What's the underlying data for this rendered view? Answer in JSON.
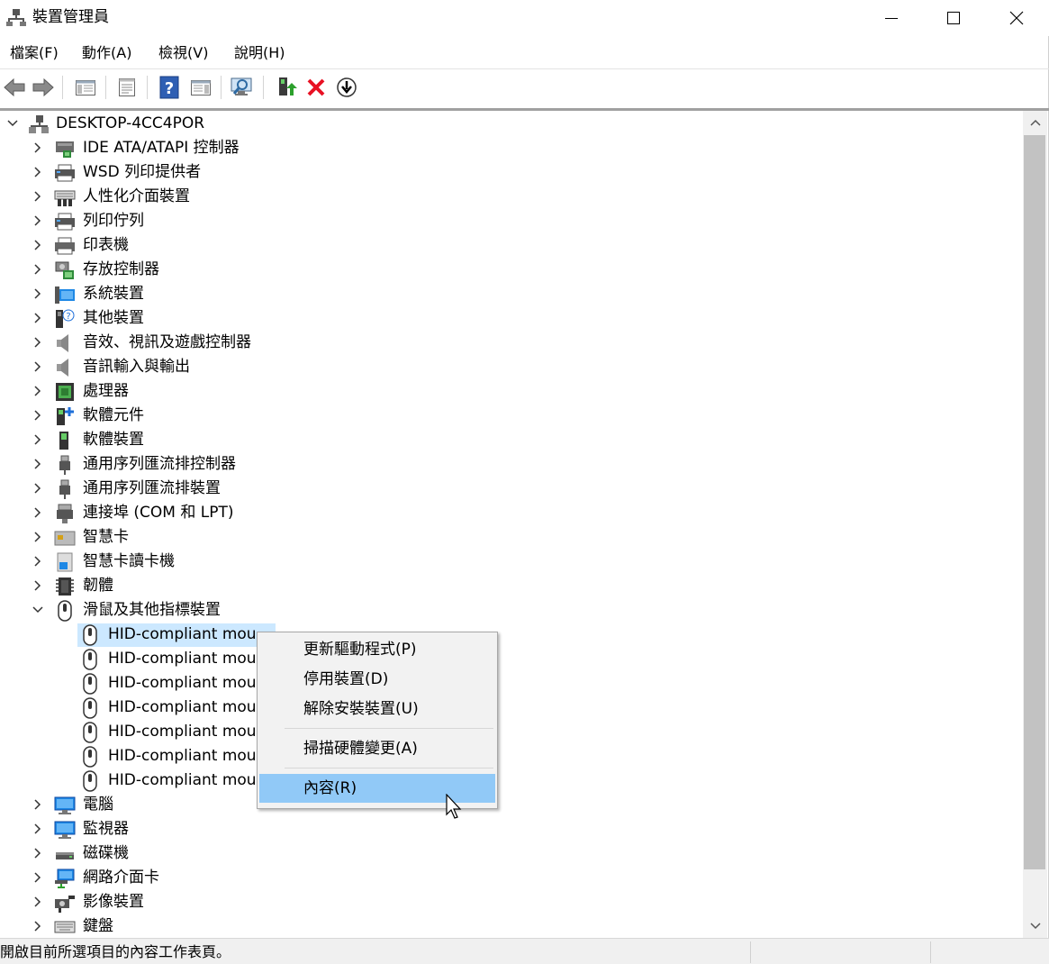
{
  "window": {
    "title": "裝置管理員",
    "controls": {
      "minimize": "minimize-icon",
      "maximize": "maximize-icon",
      "close": "close-icon"
    }
  },
  "menubar": [
    {
      "label": "檔案(F)"
    },
    {
      "label": "動作(A)"
    },
    {
      "label": "檢視(V)"
    },
    {
      "label": "說明(H)"
    }
  ],
  "toolbar": {
    "icons": [
      "back-icon",
      "forward-icon",
      "show-hide-console-tree-icon",
      "properties-icon",
      "help-icon",
      "action-pane-icon",
      "scan-hardware-icon",
      "update-driver-icon",
      "uninstall-icon",
      "enable-device-icon"
    ],
    "accent_red": "#e81123"
  },
  "tree": {
    "root": {
      "label": "DESKTOP-4CC4POR",
      "expanded": true
    },
    "categories": [
      {
        "label": "IDE ATA/ATAPI 控制器",
        "icon": "ide-controller-icon"
      },
      {
        "label": "WSD 列印提供者",
        "icon": "wsd-printer-icon"
      },
      {
        "label": "人性化介面裝置",
        "icon": "hid-keyboard-icon"
      },
      {
        "label": "列印佇列",
        "icon": "print-queue-icon"
      },
      {
        "label": "印表機",
        "icon": "printer-icon"
      },
      {
        "label": "存放控制器",
        "icon": "storage-controller-icon"
      },
      {
        "label": "系統裝置",
        "icon": "system-device-icon"
      },
      {
        "label": "其他裝置",
        "icon": "other-device-icon"
      },
      {
        "label": "音效、視訊及遊戲控制器",
        "icon": "speaker-icon"
      },
      {
        "label": "音訊輸入與輸出",
        "icon": "audio-io-icon"
      },
      {
        "label": "處理器",
        "icon": "processor-icon"
      },
      {
        "label": "軟體元件",
        "icon": "software-component-icon"
      },
      {
        "label": "軟體裝置",
        "icon": "software-device-icon"
      },
      {
        "label": "通用序列匯流排控制器",
        "icon": "usb-controller-icon"
      },
      {
        "label": "通用序列匯流排裝置",
        "icon": "usb-device-icon"
      },
      {
        "label": "連接埠 (COM 和 LPT)",
        "icon": "port-icon"
      },
      {
        "label": "智慧卡",
        "icon": "smart-card-icon"
      },
      {
        "label": "智慧卡讀卡機",
        "icon": "smart-card-reader-icon"
      },
      {
        "label": "韌體",
        "icon": "firmware-icon"
      },
      {
        "label": "滑鼠及其他指標裝置",
        "icon": "mouse-icon",
        "expanded": true
      }
    ],
    "mouse_children": [
      {
        "label": "HID-compliant mou",
        "selected": true
      },
      {
        "label": "HID-compliant mou"
      },
      {
        "label": "HID-compliant mou"
      },
      {
        "label": "HID-compliant mou"
      },
      {
        "label": "HID-compliant mou"
      },
      {
        "label": "HID-compliant mou"
      },
      {
        "label": "HID-compliant mou"
      }
    ],
    "after": [
      {
        "label": "電腦",
        "icon": "computer-icon"
      },
      {
        "label": "監視器",
        "icon": "monitor-icon"
      },
      {
        "label": "磁碟機",
        "icon": "disk-drive-icon"
      },
      {
        "label": "網路介面卡",
        "icon": "network-adapter-icon"
      },
      {
        "label": "影像裝置",
        "icon": "camera-icon"
      },
      {
        "label": "鍵盤",
        "icon": "keyboard-icon"
      }
    ],
    "selection_color": "#cce8ff"
  },
  "context_menu": {
    "items": [
      {
        "label": "更新驅動程式(P)"
      },
      {
        "label": "停用裝置(D)"
      },
      {
        "label": "解除安裝裝置(U)"
      },
      {
        "label": "掃描硬體變更(A)"
      },
      {
        "label": "內容(R)",
        "highlighted": true
      }
    ],
    "highlight_color": "#91c9f7"
  },
  "statusbar": {
    "text": "開啟目前所選項目的內容工作表頁。"
  }
}
